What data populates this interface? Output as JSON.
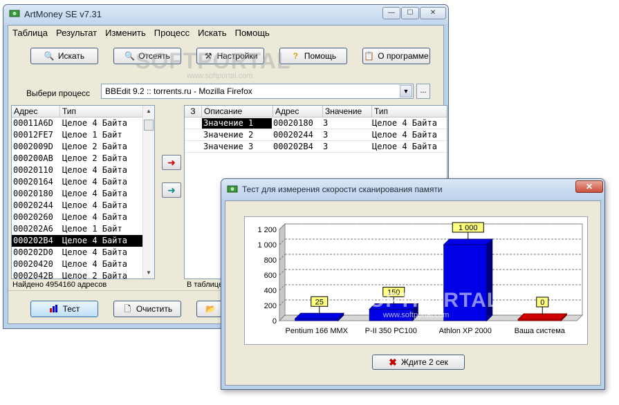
{
  "main_window": {
    "title": "ArtMoney SE v7.31",
    "menu": [
      "Таблица",
      "Результат",
      "Изменить",
      "Процесс",
      "Искать",
      "Помощь"
    ],
    "toolbar": {
      "search": "Искать",
      "filter": "Отсеять",
      "settings": "Настройки",
      "help": "Помощь",
      "about": "О программе"
    },
    "process_label": "Выбери процесс",
    "process_value": "BBEdit 9.2 :: torrents.ru - Mozilla Firefox",
    "process_more": "...",
    "left_list": {
      "headers": [
        "Адрес",
        "Тип"
      ],
      "rows": [
        {
          "addr": "00011A6D",
          "type": "Целое 4 Байта"
        },
        {
          "addr": "00012FE7",
          "type": "Целое 1 Байт"
        },
        {
          "addr": "0002009D",
          "type": "Целое 2 Байта"
        },
        {
          "addr": "000200AB",
          "type": "Целое 2 Байта"
        },
        {
          "addr": "00020110",
          "type": "Целое 4 Байта"
        },
        {
          "addr": "00020164",
          "type": "Целое 4 Байта"
        },
        {
          "addr": "00020180",
          "type": "Целое 4 Байта"
        },
        {
          "addr": "00020244",
          "type": "Целое 4 Байта"
        },
        {
          "addr": "00020260",
          "type": "Целое 4 Байта"
        },
        {
          "addr": "000202A6",
          "type": "Целое 1 Байт"
        },
        {
          "addr": "000202B4",
          "type": "Целое 4 Байта",
          "selected": true
        },
        {
          "addr": "000202D0",
          "type": "Целое 4 Байта"
        },
        {
          "addr": "00020420",
          "type": "Целое 4 Байта"
        },
        {
          "addr": "0002042B",
          "type": "Целое 2 Байта"
        }
      ],
      "status": "Найдено 4954160 адресов"
    },
    "right_list": {
      "headers": [
        "З",
        "Описание",
        "Адрес",
        "Значение",
        "Тип"
      ],
      "rows": [
        {
          "desc": "Значение 1",
          "addr": "00020180",
          "value": "3",
          "type": "Целое 4 Байта",
          "selected": true
        },
        {
          "desc": "Значение 2",
          "addr": "00020244",
          "value": "3",
          "type": "Целое 4 Байта"
        },
        {
          "desc": "Значение 3",
          "addr": "000202B4",
          "value": "3",
          "type": "Целое 4 Байта"
        }
      ],
      "status": "В таблице"
    },
    "bottom": {
      "test": "Тест",
      "clear": "Очистить"
    }
  },
  "dialog": {
    "title": "Тест для измерения скорости сканирования памяти",
    "wait_button": "Ждите 2 сек"
  },
  "watermark": {
    "brand": "SOFTPORTAL",
    "url": "www.softportal.com"
  },
  "colors": {
    "bar_blue": "#0000e6",
    "bar_red": "#d00000",
    "label_bg": "#ffff80"
  },
  "chart_data": {
    "type": "bar",
    "categories": [
      "Pentium 166 MMX",
      "P-II 350 PC100",
      "Athlon XP 2000",
      "Ваша система"
    ],
    "values": [
      25,
      150,
      1000,
      0
    ],
    "data_labels": [
      "25",
      "150",
      "1 000",
      "0"
    ],
    "ylim": [
      0,
      1200
    ],
    "yticks": [
      "0",
      "200",
      "400",
      "600",
      "800",
      "1 000",
      "1 200"
    ],
    "grid": true,
    "legend": "none"
  }
}
